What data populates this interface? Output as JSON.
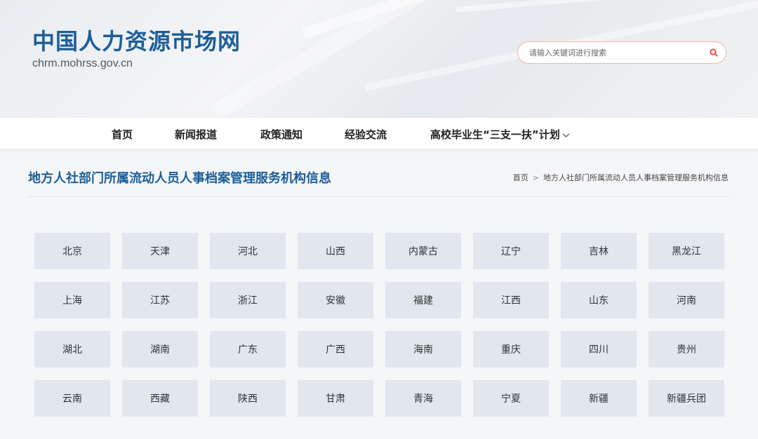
{
  "header": {
    "title": "中国人力资源市场网",
    "domain": "chrm.mohrss.gov.cn"
  },
  "search": {
    "placeholder": "请输入关键词进行搜索",
    "icon": "search-icon",
    "accent_color": "#e94e3a"
  },
  "nav": {
    "items": [
      {
        "label": "首页"
      },
      {
        "label": "新闻报道"
      },
      {
        "label": "政策通知"
      },
      {
        "label": "经验交流"
      },
      {
        "label": "高校毕业生“三支一扶”计划"
      }
    ]
  },
  "page": {
    "title": "地方人社部门所属流动人员人事档案管理服务机构信息",
    "breadcrumb": {
      "home": "首页",
      "separator": ">",
      "current": "地方人社部门所属流动人员人事档案管理服务机构信息"
    }
  },
  "regions": [
    "北京",
    "天津",
    "河北",
    "山西",
    "内蒙古",
    "辽宁",
    "吉林",
    "黑龙江",
    "上海",
    "江苏",
    "浙江",
    "安徽",
    "福建",
    "江西",
    "山东",
    "河南",
    "湖北",
    "湖南",
    "广东",
    "广西",
    "海南",
    "重庆",
    "四川",
    "贵州",
    "云南",
    "西藏",
    "陕西",
    "甘肃",
    "青海",
    "宁夏",
    "新疆",
    "新疆兵团"
  ],
  "colors": {
    "brand": "#1d5e98",
    "cell_bg": "#e2e6ed"
  }
}
